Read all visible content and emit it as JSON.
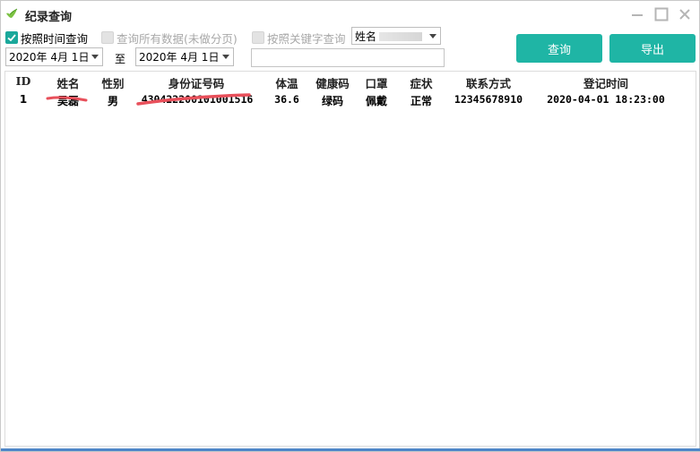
{
  "window": {
    "title": "纪录查询"
  },
  "filters": {
    "by_time": {
      "label": "按照时间查询",
      "checked": true
    },
    "all_data": {
      "label": "查询所有数据(未做分页)",
      "checked": false
    },
    "by_keyword": {
      "label": "按照关键字查询",
      "checked": false
    },
    "keyword_field": "姓名",
    "start_date": "2020年  4月  1日",
    "to_label": "至",
    "end_date": "2020年  4月  1日",
    "keyword_value": ""
  },
  "buttons": {
    "query": "查询",
    "export": "导出"
  },
  "table": {
    "columns": [
      "ID",
      "姓名",
      "性别",
      "身份证号码",
      "体温",
      "健康码",
      "口罩",
      "症状",
      "联系方式",
      "登记时间"
    ],
    "rows": [
      [
        "1",
        "吴磊",
        "男",
        "430422200101001516",
        "36.6",
        "绿码",
        "佩戴",
        "正常",
        "12345678910",
        "2020-04-01 18:23:00"
      ]
    ]
  },
  "colors": {
    "accent": "#1fb5a5",
    "checkbox": "#1aa89b",
    "redaction": "#e8505b",
    "taskbar": "#4e86c8"
  }
}
